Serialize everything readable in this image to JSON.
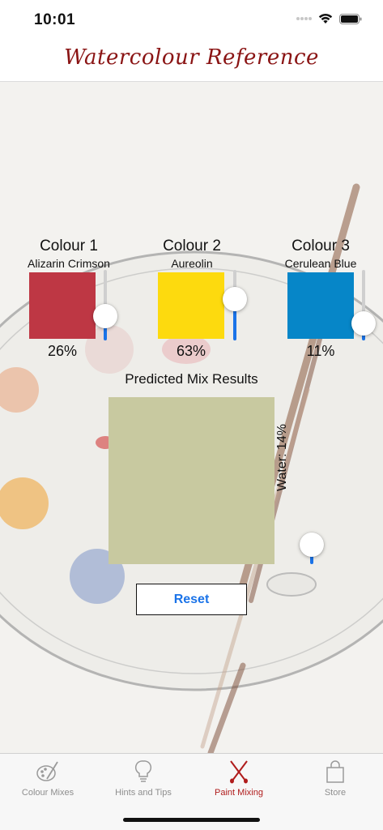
{
  "status": {
    "time": "10:01"
  },
  "nav": {
    "title": "Watercolour Reference"
  },
  "colours": [
    {
      "title": "Colour 1",
      "name": "Alizarin Crimson",
      "percent_label": "26%",
      "value": 0.26,
      "swatch": "#be3744"
    },
    {
      "title": "Colour 2",
      "name": "Aureolin",
      "percent_label": "63%",
      "value": 0.63,
      "swatch": "#fdda0e"
    },
    {
      "title": "Colour 3",
      "name": "Cerulean Blue",
      "percent_label": "11%",
      "value": 0.11,
      "swatch": "#0686c8"
    }
  ],
  "mix": {
    "title": "Predicted Mix Results",
    "swatch": "#c8c9a0",
    "water_label": "Water: 14%",
    "water_value": 0.14
  },
  "reset_label": "Reset",
  "tabs": [
    {
      "label": "Colour Mixes",
      "icon": "palette-brush-icon",
      "active": false
    },
    {
      "label": "Hints and Tips",
      "icon": "lightbulb-icon",
      "active": false
    },
    {
      "label": "Paint Mixing",
      "icon": "crossed-brushes-icon",
      "active": true
    },
    {
      "label": "Store",
      "icon": "shopping-bag-icon",
      "active": false
    }
  ],
  "accent": "#1a73e8",
  "brand": "#8a1414"
}
